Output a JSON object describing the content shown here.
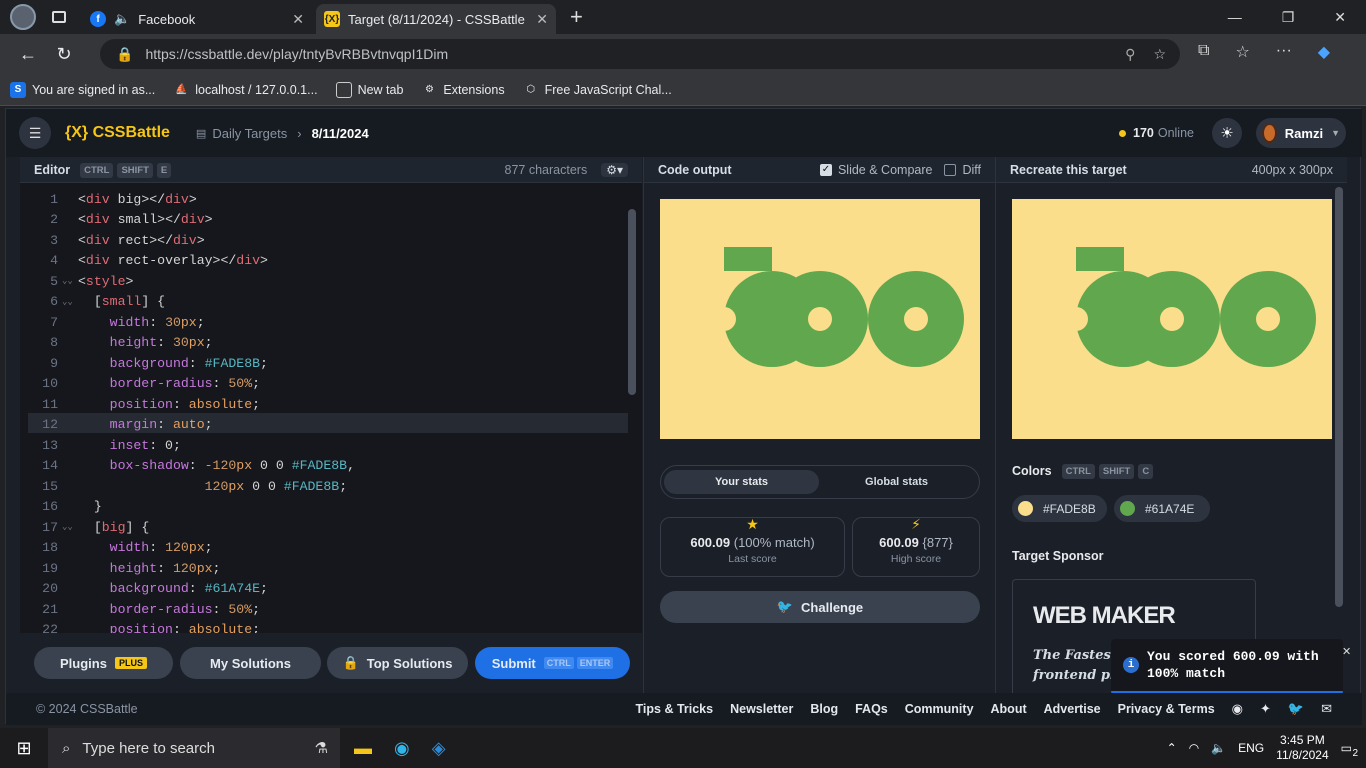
{
  "tabs": [
    {
      "title": "Facebook",
      "active": false
    },
    {
      "title": "Target (8/11/2024) - CSSBattle",
      "active": true
    }
  ],
  "address": {
    "url": "https://cssbattle.dev/play/tntyBvRBBvtnvqpI1Dim"
  },
  "bookmarks": [
    {
      "label": "You are signed in as..."
    },
    {
      "label": "localhost / 127.0.0.1..."
    },
    {
      "label": "New tab"
    },
    {
      "label": "Extensions"
    },
    {
      "label": "Free JavaScript Chal..."
    }
  ],
  "header": {
    "logo": "{X} CSSBattle",
    "breadcrumb_parent": "Daily Targets",
    "breadcrumb_current": "8/11/2024",
    "online_count": "170",
    "online_label": "Online",
    "username": "Ramzi"
  },
  "editor": {
    "title": "Editor",
    "keys": [
      "CTRL",
      "SHIFT",
      "E"
    ],
    "char_count": "877 characters",
    "lines": [
      "<div big></div>",
      "<div small></div>",
      "<div rect></div>",
      "<div rect-overlay></div>",
      "<style>",
      "  [small] {",
      "    width: 30px;",
      "    height: 30px;",
      "    background: #FADE8B;",
      "    border-radius: 50%;",
      "    position: absolute;",
      "    margin: auto;",
      "    inset: 0;",
      "    box-shadow: -120px 0 0 #FADE8B,",
      "                120px 0 0 #FADE8B;",
      "  }",
      "  [big] {",
      "    width: 120px;",
      "    height: 120px;",
      "    background: #61A74E;",
      "    border-radius: 50%;",
      "    position: absolute;"
    ],
    "line_numbers": [
      "1",
      "2",
      "3",
      "4",
      "5",
      "6",
      "7",
      "8",
      "9",
      "10",
      "11",
      "12",
      "13",
      "14",
      "15",
      "16",
      "17",
      "18",
      "19",
      "20",
      "21",
      "22"
    ]
  },
  "bottom_buttons": {
    "plugins": "Plugins",
    "plus_badge": "PLUS",
    "my_solutions": "My Solutions",
    "top_solutions": "Top Solutions",
    "submit": "Submit",
    "submit_keys": [
      "CTRL",
      "ENTER"
    ]
  },
  "output": {
    "title": "Code output",
    "slide_compare": "Slide & Compare",
    "diff": "Diff",
    "tab_your": "Your stats",
    "tab_global": "Global stats",
    "last_score_value": "600.09",
    "last_score_match": "(100% match)",
    "last_score_label": "Last score",
    "high_score_value": "600.09",
    "high_score_chars": "{877}",
    "high_score_label": "High score",
    "challenge": "Challenge"
  },
  "target": {
    "title": "Recreate this target",
    "size": "400px x 300px",
    "colors_title": "Colors",
    "colors_keys": [
      "CTRL",
      "SHIFT",
      "C"
    ],
    "colors": [
      {
        "hex": "#FADE8B"
      },
      {
        "hex": "#61A74E"
      }
    ],
    "sponsor_title": "Target Sponsor",
    "sponsor_logo": "WEB MAKER",
    "sponsor_text1": "The Fastest",
    "sponsor_text2": "frontend pl"
  },
  "toast": {
    "message": "You scored 600.09 with 100% match"
  },
  "footer": {
    "copyright": "© 2024 CSSBattle",
    "links": [
      "Tips & Tricks",
      "Newsletter",
      "Blog",
      "FAQs",
      "Community",
      "About",
      "Advertise",
      "Privacy & Terms"
    ]
  },
  "taskbar": {
    "search_placeholder": "Type here to search",
    "lang": "ENG",
    "time": "3:45 PM",
    "date": "11/8/2024",
    "notification_count": "2"
  },
  "colors": {
    "yellow": "#FADE8B",
    "green": "#61A74E",
    "accent": "#1f6fe5"
  }
}
